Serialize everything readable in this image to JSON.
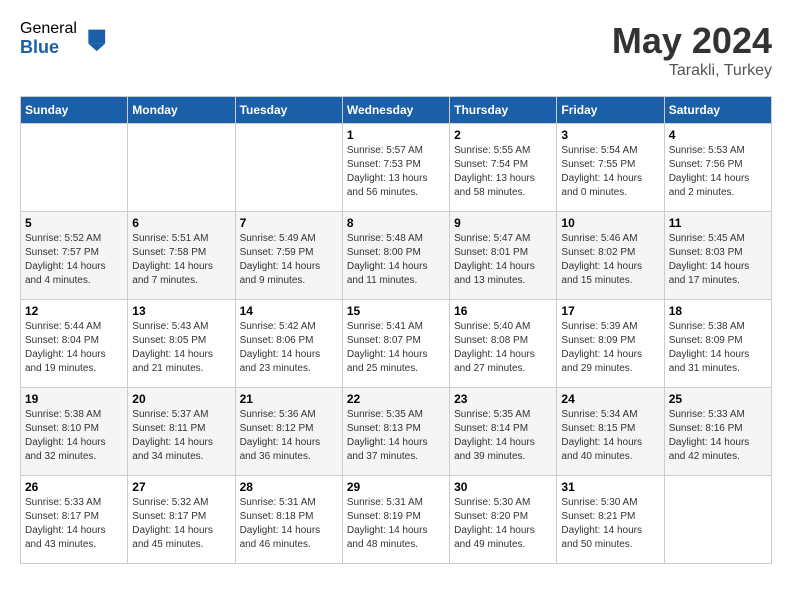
{
  "logo": {
    "general": "General",
    "blue": "Blue"
  },
  "title": "May 2024",
  "subtitle": "Tarakli, Turkey",
  "days_of_week": [
    "Sunday",
    "Monday",
    "Tuesday",
    "Wednesday",
    "Thursday",
    "Friday",
    "Saturday"
  ],
  "weeks": [
    [
      {
        "day": "",
        "info": ""
      },
      {
        "day": "",
        "info": ""
      },
      {
        "day": "",
        "info": ""
      },
      {
        "day": "1",
        "info": "Sunrise: 5:57 AM\nSunset: 7:53 PM\nDaylight: 13 hours\nand 56 minutes."
      },
      {
        "day": "2",
        "info": "Sunrise: 5:55 AM\nSunset: 7:54 PM\nDaylight: 13 hours\nand 58 minutes."
      },
      {
        "day": "3",
        "info": "Sunrise: 5:54 AM\nSunset: 7:55 PM\nDaylight: 14 hours\nand 0 minutes."
      },
      {
        "day": "4",
        "info": "Sunrise: 5:53 AM\nSunset: 7:56 PM\nDaylight: 14 hours\nand 2 minutes."
      }
    ],
    [
      {
        "day": "5",
        "info": "Sunrise: 5:52 AM\nSunset: 7:57 PM\nDaylight: 14 hours\nand 4 minutes."
      },
      {
        "day": "6",
        "info": "Sunrise: 5:51 AM\nSunset: 7:58 PM\nDaylight: 14 hours\nand 7 minutes."
      },
      {
        "day": "7",
        "info": "Sunrise: 5:49 AM\nSunset: 7:59 PM\nDaylight: 14 hours\nand 9 minutes."
      },
      {
        "day": "8",
        "info": "Sunrise: 5:48 AM\nSunset: 8:00 PM\nDaylight: 14 hours\nand 11 minutes."
      },
      {
        "day": "9",
        "info": "Sunrise: 5:47 AM\nSunset: 8:01 PM\nDaylight: 14 hours\nand 13 minutes."
      },
      {
        "day": "10",
        "info": "Sunrise: 5:46 AM\nSunset: 8:02 PM\nDaylight: 14 hours\nand 15 minutes."
      },
      {
        "day": "11",
        "info": "Sunrise: 5:45 AM\nSunset: 8:03 PM\nDaylight: 14 hours\nand 17 minutes."
      }
    ],
    [
      {
        "day": "12",
        "info": "Sunrise: 5:44 AM\nSunset: 8:04 PM\nDaylight: 14 hours\nand 19 minutes."
      },
      {
        "day": "13",
        "info": "Sunrise: 5:43 AM\nSunset: 8:05 PM\nDaylight: 14 hours\nand 21 minutes."
      },
      {
        "day": "14",
        "info": "Sunrise: 5:42 AM\nSunset: 8:06 PM\nDaylight: 14 hours\nand 23 minutes."
      },
      {
        "day": "15",
        "info": "Sunrise: 5:41 AM\nSunset: 8:07 PM\nDaylight: 14 hours\nand 25 minutes."
      },
      {
        "day": "16",
        "info": "Sunrise: 5:40 AM\nSunset: 8:08 PM\nDaylight: 14 hours\nand 27 minutes."
      },
      {
        "day": "17",
        "info": "Sunrise: 5:39 AM\nSunset: 8:09 PM\nDaylight: 14 hours\nand 29 minutes."
      },
      {
        "day": "18",
        "info": "Sunrise: 5:38 AM\nSunset: 8:09 PM\nDaylight: 14 hours\nand 31 minutes."
      }
    ],
    [
      {
        "day": "19",
        "info": "Sunrise: 5:38 AM\nSunset: 8:10 PM\nDaylight: 14 hours\nand 32 minutes."
      },
      {
        "day": "20",
        "info": "Sunrise: 5:37 AM\nSunset: 8:11 PM\nDaylight: 14 hours\nand 34 minutes."
      },
      {
        "day": "21",
        "info": "Sunrise: 5:36 AM\nSunset: 8:12 PM\nDaylight: 14 hours\nand 36 minutes."
      },
      {
        "day": "22",
        "info": "Sunrise: 5:35 AM\nSunset: 8:13 PM\nDaylight: 14 hours\nand 37 minutes."
      },
      {
        "day": "23",
        "info": "Sunrise: 5:35 AM\nSunset: 8:14 PM\nDaylight: 14 hours\nand 39 minutes."
      },
      {
        "day": "24",
        "info": "Sunrise: 5:34 AM\nSunset: 8:15 PM\nDaylight: 14 hours\nand 40 minutes."
      },
      {
        "day": "25",
        "info": "Sunrise: 5:33 AM\nSunset: 8:16 PM\nDaylight: 14 hours\nand 42 minutes."
      }
    ],
    [
      {
        "day": "26",
        "info": "Sunrise: 5:33 AM\nSunset: 8:17 PM\nDaylight: 14 hours\nand 43 minutes."
      },
      {
        "day": "27",
        "info": "Sunrise: 5:32 AM\nSunset: 8:17 PM\nDaylight: 14 hours\nand 45 minutes."
      },
      {
        "day": "28",
        "info": "Sunrise: 5:31 AM\nSunset: 8:18 PM\nDaylight: 14 hours\nand 46 minutes."
      },
      {
        "day": "29",
        "info": "Sunrise: 5:31 AM\nSunset: 8:19 PM\nDaylight: 14 hours\nand 48 minutes."
      },
      {
        "day": "30",
        "info": "Sunrise: 5:30 AM\nSunset: 8:20 PM\nDaylight: 14 hours\nand 49 minutes."
      },
      {
        "day": "31",
        "info": "Sunrise: 5:30 AM\nSunset: 8:21 PM\nDaylight: 14 hours\nand 50 minutes."
      },
      {
        "day": "",
        "info": ""
      }
    ]
  ]
}
